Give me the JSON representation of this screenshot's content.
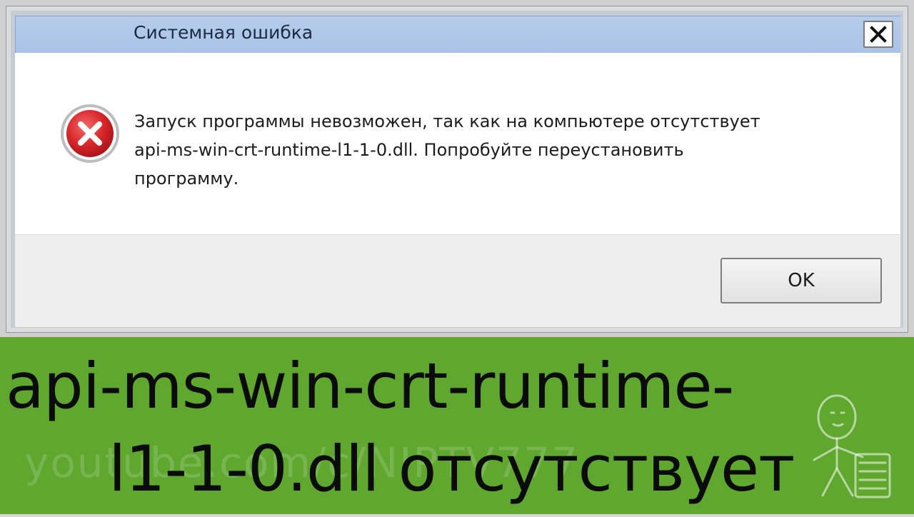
{
  "dialog": {
    "title": "Системная ошибка",
    "message": "Запуск программы невозможен, так как на компьютере отсутствует\napi-ms-win-crt-runtime-l1-1-0.dll. Попробуйте переустановить\nпрограмму.",
    "ok_label": "OK",
    "icons": {
      "close": "close-icon",
      "error": "error-icon"
    }
  },
  "banner": {
    "line1": "api-ms-win-crt-runtime-",
    "line2": "l1-1-0.dll отсутствует",
    "watermark": "youtube.com/c/NIPTV777",
    "background": "#5fa72f"
  },
  "colors": {
    "titlebar": "#b0c7e8",
    "error_red": "#d8272b"
  }
}
